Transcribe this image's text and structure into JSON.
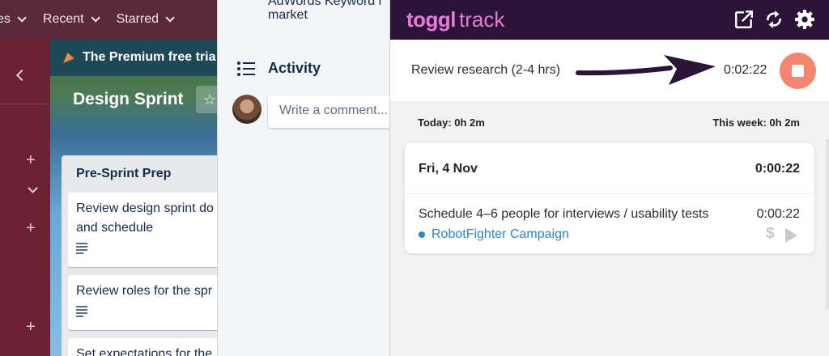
{
  "trello": {
    "topbar": {
      "nav_partial": "es",
      "recent": "Recent",
      "starred": "Starred"
    },
    "banner": "The Premium free tria",
    "board_title": "Design Sprint",
    "list": {
      "title": "Pre-Sprint Prep",
      "cards": [
        "Review design sprint do and schedule",
        "Review roles for the spr",
        "Set expectations for the"
      ]
    },
    "card_detail": {
      "prev_line": "AdWords Keyword r",
      "prev_line2": "market",
      "activity": "Activity",
      "comment_placeholder": "Write a comment..."
    }
  },
  "toggl": {
    "logo_brand": "toggl",
    "logo_sub": "track",
    "running": {
      "description": "Review research (2-4 hrs)",
      "elapsed": "0:02:22"
    },
    "summary": {
      "today": "Today: 0h 2m",
      "week": "This week: 0h 2m"
    },
    "day": {
      "date": "Fri, 4 Nov",
      "total": "0:00:22",
      "entries": [
        {
          "description": "Schedule 4–6 people for interviews / usability tests",
          "duration": "0:00:22",
          "project": "RobotFighter Campaign",
          "project_color": "#2b86c8"
        }
      ]
    },
    "header_icons": [
      "external-link-icon",
      "sync-icon",
      "gear-icon"
    ],
    "colors": {
      "header": "#2c1338",
      "brand": "#e57cd8",
      "stop": "#f4866f"
    }
  }
}
